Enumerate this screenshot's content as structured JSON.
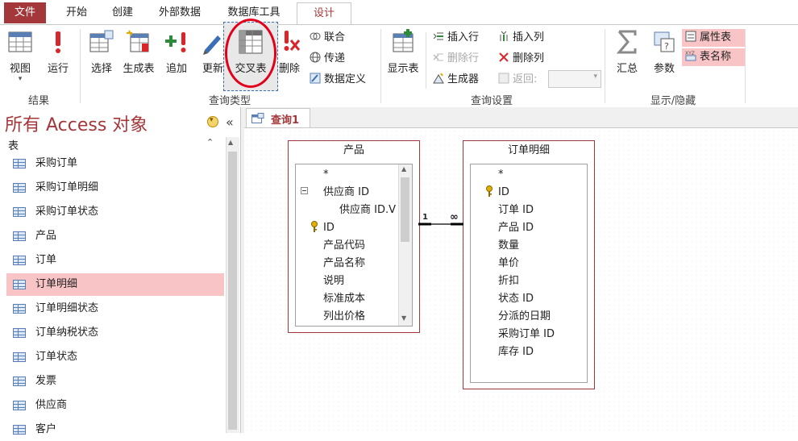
{
  "ribbon_tabs": [
    {
      "label": "文件"
    },
    {
      "label": "开始"
    },
    {
      "label": "创建"
    },
    {
      "label": "外部数据"
    },
    {
      "label": "数据库工具"
    },
    {
      "label": "设计"
    }
  ],
  "groups": {
    "results": {
      "label": "结果",
      "view_label": "视图",
      "run_label": "运行"
    },
    "query_type": {
      "label": "查询类型",
      "select_label": "选择",
      "make_table_label": "生成表",
      "append_label": "追加",
      "update_label": "更新",
      "crosstab_label": "交叉表",
      "delete_label": "删除",
      "union_label": "联合",
      "passthrough_label": "传递",
      "data_def_label": "数据定义"
    },
    "query_setup": {
      "label": "查询设置",
      "show_table_label": "显示表",
      "insert_rows_label": "插入行",
      "delete_rows_label": "删除行",
      "builder_label": "生成器",
      "insert_cols_label": "插入列",
      "delete_cols_label": "删除列",
      "return_label": "返回:"
    },
    "show_hide": {
      "label": "显示/隐藏",
      "totals_label": "汇总",
      "params_label": "参数",
      "property_sheet_label": "属性表",
      "table_names_label": "表名称"
    }
  },
  "nav": {
    "title": "所有 Access 对象",
    "section": "表",
    "items": [
      "采购订单",
      "采购订单明细",
      "采购订单状态",
      "产品",
      "订单",
      "订单明细",
      "订单明细状态",
      "订单纳税状态",
      "订单状态",
      "发票",
      "供应商",
      "客户"
    ],
    "selected_index": 5
  },
  "document": {
    "tab_label": "查询1"
  },
  "tables": {
    "product": {
      "title": "产品",
      "fields": [
        "*",
        "供应商 ID",
        "供应商 ID.V",
        "ID",
        "产品代码",
        "产品名称",
        "说明",
        "标准成本",
        "列出价格"
      ]
    },
    "order_detail": {
      "title": "订单明细",
      "fields": [
        "*",
        "ID",
        "订单 ID",
        "产品 ID",
        "数量",
        "单价",
        "折扣",
        "状态 ID",
        "分派的日期",
        "采购订单 ID",
        "库存 ID"
      ]
    }
  },
  "relationship": {
    "one_label": "1",
    "many_label": "∞"
  },
  "colors": {
    "accent": "#a4373a",
    "highlight_circle": "#e3001b",
    "selected_nav": "#f8c4c6"
  }
}
